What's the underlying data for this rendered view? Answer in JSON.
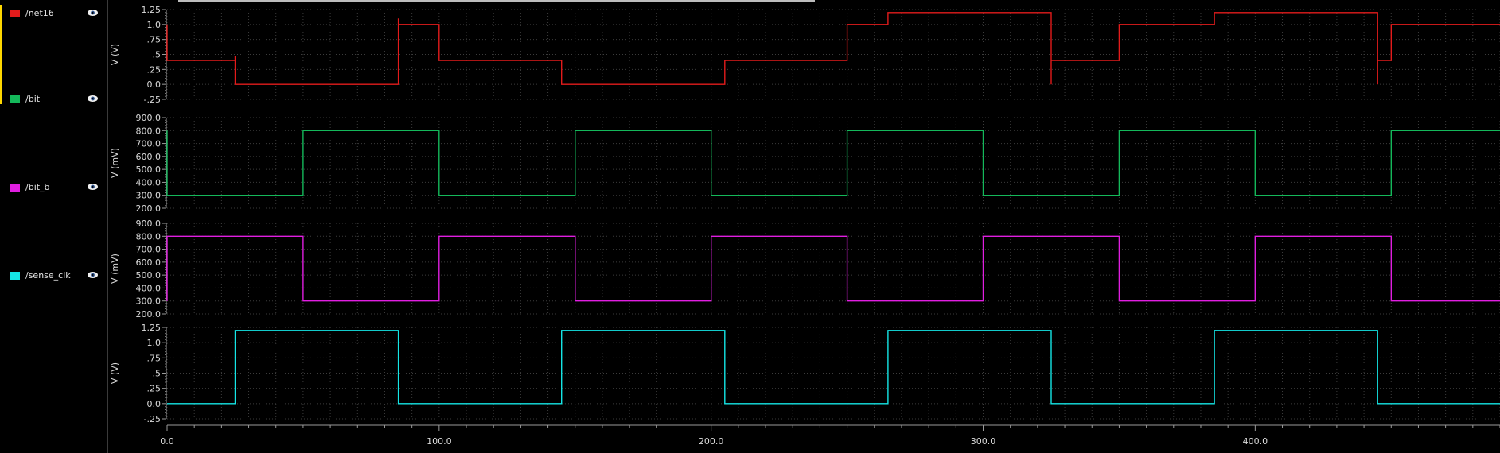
{
  "legend": {
    "items": [
      {
        "name": "/net16",
        "color": "#e31b1b",
        "icon": "eye-icon"
      },
      {
        "name": "/bit",
        "color": "#14b85a",
        "icon": "eye-icon"
      },
      {
        "name": "/bit_b",
        "color": "#e01ee0",
        "icon": "eye-icon"
      },
      {
        "name": "/sense_clk",
        "color": "#15e6e6",
        "icon": "eye-icon"
      }
    ]
  },
  "chart_data": {
    "type": "line",
    "x_range": [
      0,
      490
    ],
    "x_ticks": [
      0,
      100,
      200,
      300,
      400
    ],
    "x_tick_labels": [
      "0.0",
      "100.0",
      "200.0",
      "300.0",
      "400.0"
    ],
    "xlabel": "",
    "grid": true,
    "panels": [
      {
        "series_name": "/net16",
        "color": "#e31b1b",
        "ylabel": "V (V)",
        "ylim": [
          -0.25,
          1.25
        ],
        "y_ticks": [
          1.25,
          1.0,
          0.75,
          0.5,
          0.25,
          0.0,
          -0.25
        ],
        "y_tick_labels": [
          "1.25",
          "1.0",
          ".75",
          ".5",
          ".25",
          "0.0",
          "-.25"
        ],
        "points": [
          [
            0,
            1.0
          ],
          [
            0,
            0.4
          ],
          [
            25,
            0.4
          ],
          [
            25,
            0.48
          ],
          [
            25,
            0.0
          ],
          [
            85,
            0.0
          ],
          [
            85,
            1.1
          ],
          [
            85,
            1.0
          ],
          [
            100,
            1.0
          ],
          [
            100,
            0.4
          ],
          [
            145,
            0.4
          ],
          [
            145,
            0.0
          ],
          [
            205,
            0.0
          ],
          [
            205,
            0.4
          ],
          [
            250,
            0.4
          ],
          [
            250,
            1.0
          ],
          [
            265,
            1.0
          ],
          [
            265,
            1.2
          ],
          [
            325,
            1.2
          ],
          [
            325,
            0.0
          ],
          [
            325,
            0.4
          ],
          [
            350,
            0.4
          ],
          [
            350,
            1.0
          ],
          [
            385,
            1.0
          ],
          [
            385,
            1.2
          ],
          [
            445,
            1.2
          ],
          [
            445,
            0.0
          ],
          [
            445,
            0.4
          ],
          [
            450,
            0.4
          ],
          [
            450,
            1.0
          ],
          [
            490,
            1.0
          ]
        ]
      },
      {
        "series_name": "/bit",
        "color": "#14b85a",
        "ylabel": "V (mV)",
        "ylim": [
          200,
          900
        ],
        "y_ticks": [
          900,
          800,
          700,
          600,
          500,
          400,
          300,
          200
        ],
        "y_tick_labels": [
          "900.0",
          "800.0",
          "700.0",
          "600.0",
          "500.0",
          "400.0",
          "300.0",
          "200.0"
        ],
        "points": [
          [
            0,
            800
          ],
          [
            0,
            300
          ],
          [
            50,
            300
          ],
          [
            50,
            800
          ],
          [
            100,
            800
          ],
          [
            100,
            300
          ],
          [
            150,
            300
          ],
          [
            150,
            800
          ],
          [
            200,
            800
          ],
          [
            200,
            300
          ],
          [
            250,
            300
          ],
          [
            250,
            800
          ],
          [
            300,
            800
          ],
          [
            300,
            300
          ],
          [
            350,
            300
          ],
          [
            350,
            800
          ],
          [
            400,
            800
          ],
          [
            400,
            300
          ],
          [
            450,
            300
          ],
          [
            450,
            800
          ],
          [
            490,
            800
          ]
        ]
      },
      {
        "series_name": "/bit_b",
        "color": "#e01ee0",
        "ylabel": "V (mV)",
        "ylim": [
          200,
          900
        ],
        "y_ticks": [
          900,
          800,
          700,
          600,
          500,
          400,
          300,
          200
        ],
        "y_tick_labels": [
          "900.0",
          "800.0",
          "700.0",
          "600.0",
          "500.0",
          "400.0",
          "300.0",
          "200.0"
        ],
        "points": [
          [
            0,
            300
          ],
          [
            0,
            800
          ],
          [
            50,
            800
          ],
          [
            50,
            300
          ],
          [
            100,
            300
          ],
          [
            100,
            800
          ],
          [
            150,
            800
          ],
          [
            150,
            300
          ],
          [
            200,
            300
          ],
          [
            200,
            800
          ],
          [
            250,
            800
          ],
          [
            250,
            300
          ],
          [
            300,
            300
          ],
          [
            300,
            800
          ],
          [
            350,
            800
          ],
          [
            350,
            300
          ],
          [
            400,
            300
          ],
          [
            400,
            800
          ],
          [
            450,
            800
          ],
          [
            450,
            300
          ],
          [
            490,
            300
          ]
        ]
      },
      {
        "series_name": "/sense_clk",
        "color": "#15e6e6",
        "ylabel": "V (V)",
        "ylim": [
          -0.25,
          1.25
        ],
        "y_ticks": [
          1.25,
          1.0,
          0.75,
          0.5,
          0.25,
          0.0,
          -0.25
        ],
        "y_tick_labels": [
          "1.25",
          "1.0",
          ".75",
          ".5",
          ".25",
          "0.0",
          "-.25"
        ],
        "points": [
          [
            0,
            0
          ],
          [
            25,
            0
          ],
          [
            25,
            1.2
          ],
          [
            85,
            1.2
          ],
          [
            85,
            0
          ],
          [
            145,
            0
          ],
          [
            145,
            1.2
          ],
          [
            205,
            1.2
          ],
          [
            205,
            0
          ],
          [
            265,
            0
          ],
          [
            265,
            1.2
          ],
          [
            325,
            1.2
          ],
          [
            325,
            0
          ],
          [
            385,
            0
          ],
          [
            385,
            1.2
          ],
          [
            445,
            1.2
          ],
          [
            445,
            0
          ],
          [
            490,
            0
          ]
        ]
      }
    ]
  }
}
